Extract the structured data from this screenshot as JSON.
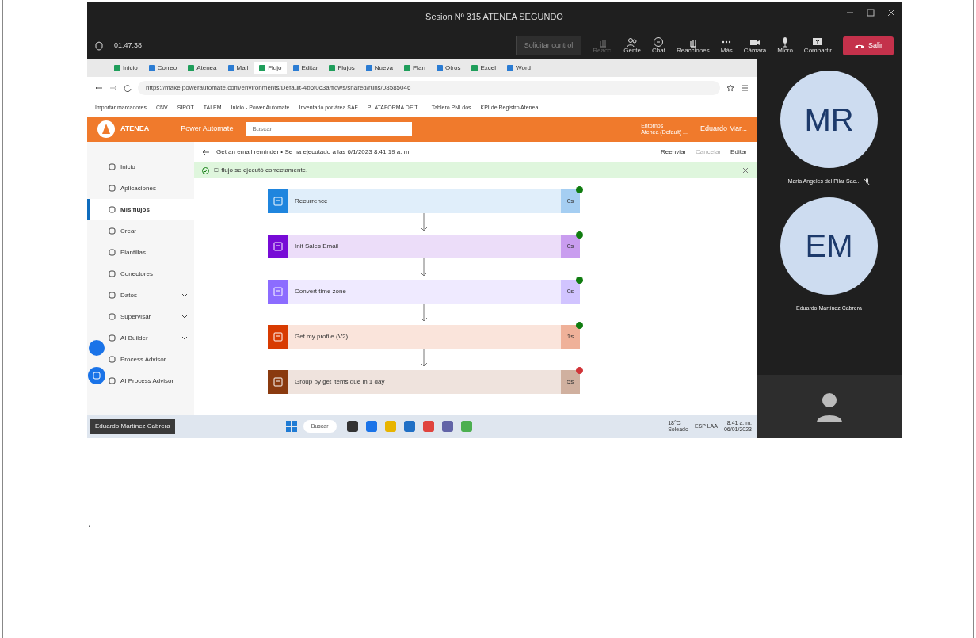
{
  "meeting": {
    "title": "Sesion Nº 315 ATENEA SEGUNDO",
    "timer": "01:47:38",
    "toolbar": [
      {
        "label": "Solicitar control",
        "kind": "field"
      },
      {
        "label": "Reacc.",
        "kind": "disabled"
      },
      {
        "label": "Gente",
        "kind": "button"
      },
      {
        "label": "Chat",
        "kind": "button"
      },
      {
        "label": "Reacciones",
        "kind": "button"
      },
      {
        "label": "Más",
        "kind": "button"
      },
      {
        "label": "Cámara",
        "kind": "button"
      },
      {
        "label": "Micro",
        "kind": "button"
      },
      {
        "label": "Compartir",
        "kind": "button"
      },
      {
        "label": "Salir",
        "kind": "leave"
      }
    ]
  },
  "browser": {
    "tabs": [
      {
        "label": "Inicio",
        "selected": false
      },
      {
        "label": "Correo",
        "selected": false
      },
      {
        "label": "Atenea",
        "selected": false
      },
      {
        "label": "Mail",
        "selected": false
      },
      {
        "label": "Flujo",
        "selected": true
      },
      {
        "label": "Editar",
        "selected": false
      },
      {
        "label": "Flujos",
        "selected": false
      },
      {
        "label": "Nueva",
        "selected": false
      },
      {
        "label": "Plan",
        "selected": false
      },
      {
        "label": "Otros",
        "selected": false
      },
      {
        "label": "Excel",
        "selected": false
      },
      {
        "label": "Word",
        "selected": false
      }
    ],
    "address": "https://make.powerautomate.com/environments/Default-4b6f0c3a/flows/shared/runs/08585046",
    "bookmarks": [
      "Importar marcadores",
      "CNV",
      "SIPOT",
      "TALEM",
      "Inicio - Power Automate",
      "Inventario por área SAF",
      "PLATAFORMA DE T...",
      "Tablero PNI dos",
      "KPI de Registro Atenea"
    ]
  },
  "app": {
    "brand": "ATENEA",
    "product": "Power Automate",
    "search_placeholder": "Buscar",
    "environment": "Entornos",
    "environment_name": "Atenea (Default) ...",
    "user": "Eduardo Mar..."
  },
  "sidebar": [
    {
      "label": "Inicio",
      "selected": false,
      "expandable": false
    },
    {
      "label": "Aplicaciones",
      "selected": false,
      "expandable": false
    },
    {
      "label": "Mis flujos",
      "selected": true,
      "expandable": false
    },
    {
      "label": "Crear",
      "selected": false,
      "expandable": false
    },
    {
      "label": "Plantillas",
      "selected": false,
      "expandable": false
    },
    {
      "label": "Conectores",
      "selected": false,
      "expandable": false
    },
    {
      "label": "Datos",
      "selected": false,
      "expandable": true
    },
    {
      "label": "Supervisar",
      "selected": false,
      "expandable": true
    },
    {
      "label": "AI Builder",
      "selected": false,
      "expandable": true
    },
    {
      "label": "Process Advisor",
      "selected": false,
      "expandable": false
    },
    {
      "label": "AI Process Advisor",
      "selected": false,
      "expandable": false
    }
  ],
  "run": {
    "title": "Get an email reminder • Se ha ejecutado a las 6/1/2023 8:41:19 a. m.",
    "actions": [
      "Reenviar",
      "Cancelar",
      "Editar"
    ],
    "banner": "El flujo se ejecutó correctamente."
  },
  "steps": [
    {
      "label": "Recurrence",
      "duration": "0s",
      "color": "#1f85de",
      "failed": false
    },
    {
      "label": "Init Sales Email",
      "duration": "0s",
      "color": "#770bd6",
      "failed": false
    },
    {
      "label": "Convert time zone",
      "duration": "0s",
      "color": "#8c6cff",
      "failed": false
    },
    {
      "label": "Get my profile (V2)",
      "duration": "1s",
      "color": "#d83b01",
      "failed": false
    },
    {
      "label": "Group by get items due in 1 day",
      "duration": "5s",
      "color": "#8a3a0f",
      "failed": true
    }
  ],
  "sharing_label": "Eduardo Martínez Cabrera",
  "taskbar": {
    "search": "Buscar",
    "weather": "18°C",
    "weather_note": "Soleado",
    "lang": "ESP LAA",
    "time": "8:41 a. m.",
    "date": "06/01/2023"
  },
  "participants": [
    {
      "initials": "MR",
      "name": "Maria Angeles del Pilar Sae...",
      "muted": true
    },
    {
      "initials": "EM",
      "name": "Eduardo Martínez Cabrera",
      "muted": false
    }
  ],
  "document": {
    "mark": "."
  }
}
